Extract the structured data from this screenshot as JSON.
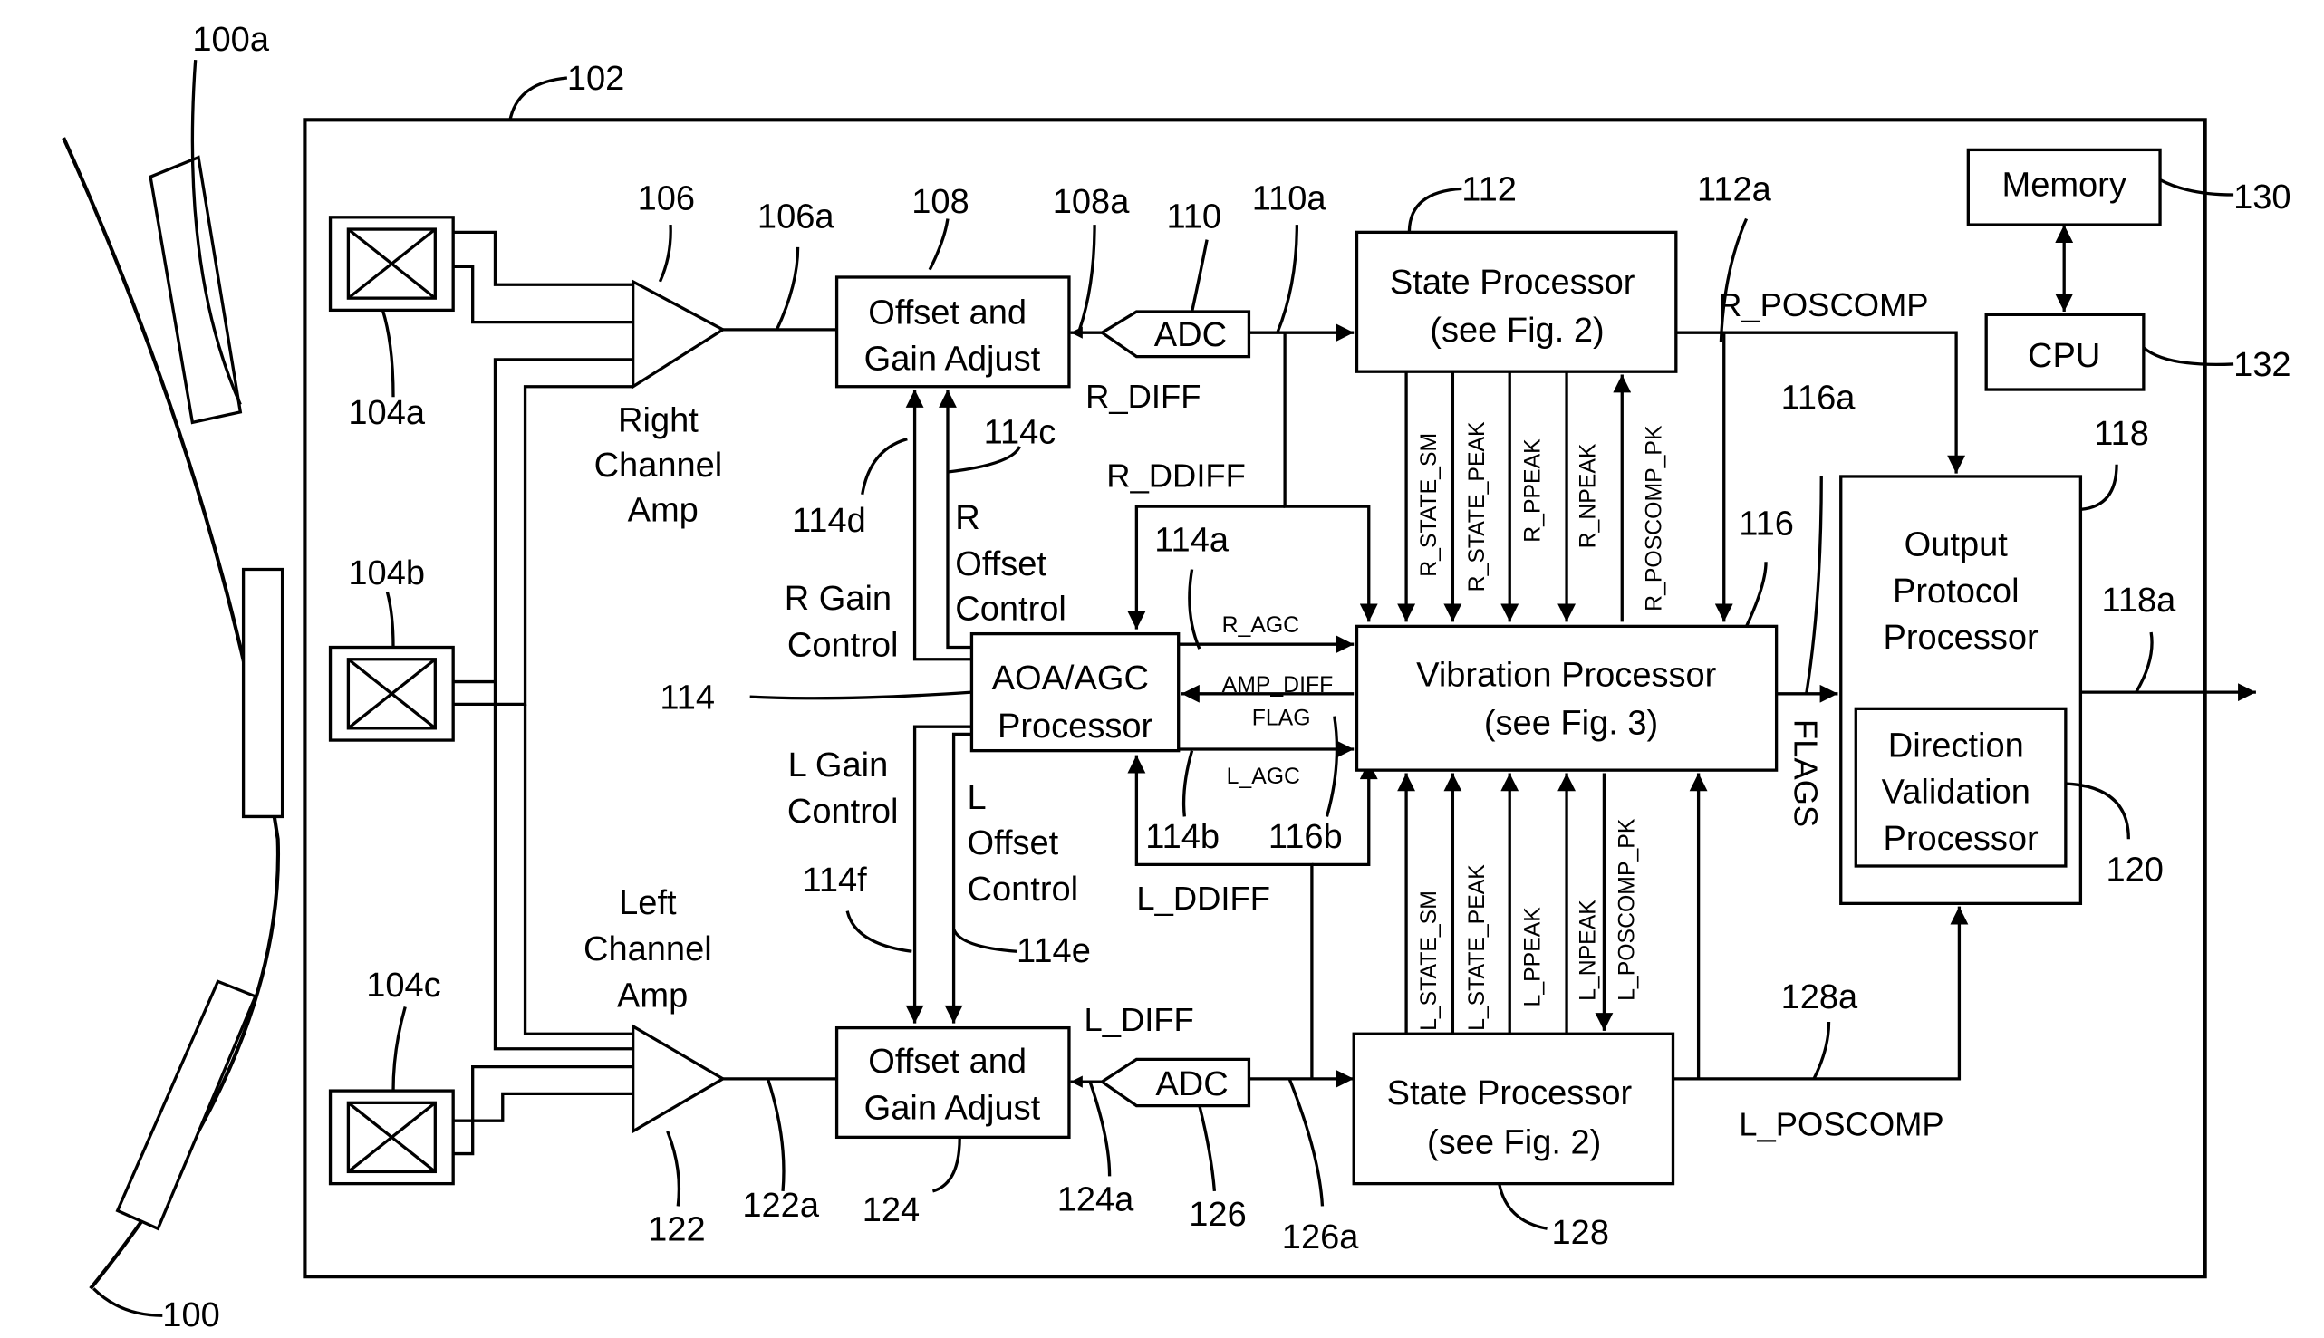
{
  "figure": {
    "refs": {
      "curve": "100",
      "curve_sensor": "100a",
      "board": "102",
      "sensor_a": "104a",
      "sensor_b": "104b",
      "sensor_c": "104c",
      "right_amp": "106",
      "right_amp_out": "106a",
      "right_offset_gain": "108",
      "right_offset_gain_out": "108a",
      "right_adc": "110",
      "right_adc_out": "110a",
      "right_state": "112",
      "right_state_out": "112a",
      "aoa": "114",
      "aoa_a": "114a",
      "aoa_b": "114b",
      "aoa_c": "114c",
      "aoa_d": "114d",
      "aoa_e": "114e",
      "aoa_f": "114f",
      "vib": "116",
      "vib_a": "116a",
      "vib_b": "116b",
      "output": "118",
      "output_out": "118a",
      "dir_valid": "120",
      "left_amp": "122",
      "left_amp_out": "122a",
      "left_offset_gain": "124",
      "left_offset_gain_out": "124a",
      "left_adc": "126",
      "left_adc_out": "126a",
      "left_state": "128",
      "left_state_out": "128a",
      "memory": "130",
      "cpu": "132"
    },
    "blocks": {
      "offset_gain": [
        "Offset and",
        "Gain Adjust"
      ],
      "adc": "ADC",
      "state": [
        "State Processor",
        "(see Fig. 2)"
      ],
      "aoa": [
        "AOA/AGC",
        "Processor"
      ],
      "vib": [
        "Vibration Processor",
        "(see Fig. 3)"
      ],
      "output": [
        "Output",
        "Protocol",
        "Processor"
      ],
      "dir_valid": [
        "Direction",
        "Validation",
        "Processor"
      ],
      "memory": "Memory",
      "cpu": "CPU"
    },
    "labels": {
      "right_amp": [
        "Right",
        "Channel",
        "Amp"
      ],
      "left_amp": [
        "Left",
        "Channel",
        "Amp"
      ],
      "r_gain": [
        "R Gain",
        "Control"
      ],
      "l_gain": [
        "L Gain",
        "Control"
      ],
      "r_offset": [
        "R",
        "Offset",
        "Control"
      ],
      "l_offset": [
        "L",
        "Offset",
        "Control"
      ]
    },
    "signals": {
      "r_diff": "R_DIFF",
      "l_diff": "L_DIFF",
      "r_ddiff": "R_DDIFF",
      "l_ddiff": "L_DDIFF",
      "r_agc": "R_AGC",
      "l_agc": "L_AGC",
      "amp_diff": "AMP_DIFF",
      "flag": "FLAG",
      "flags": "FLAGS",
      "r_poscomp": "R_POSCOMP",
      "l_poscomp": "L_POSCOMP",
      "r_vert": [
        "R_STATE_SM",
        "R_STATE_PEAK",
        "R_PPEAK",
        "R_NPEAK",
        "R_POSCOMP_PK"
      ],
      "l_vert": [
        "L_STATE_SM",
        "L_STATE_PEAK",
        "L_PPEAK",
        "L_NPEAK",
        "L_POSCOMP_PK"
      ]
    }
  }
}
